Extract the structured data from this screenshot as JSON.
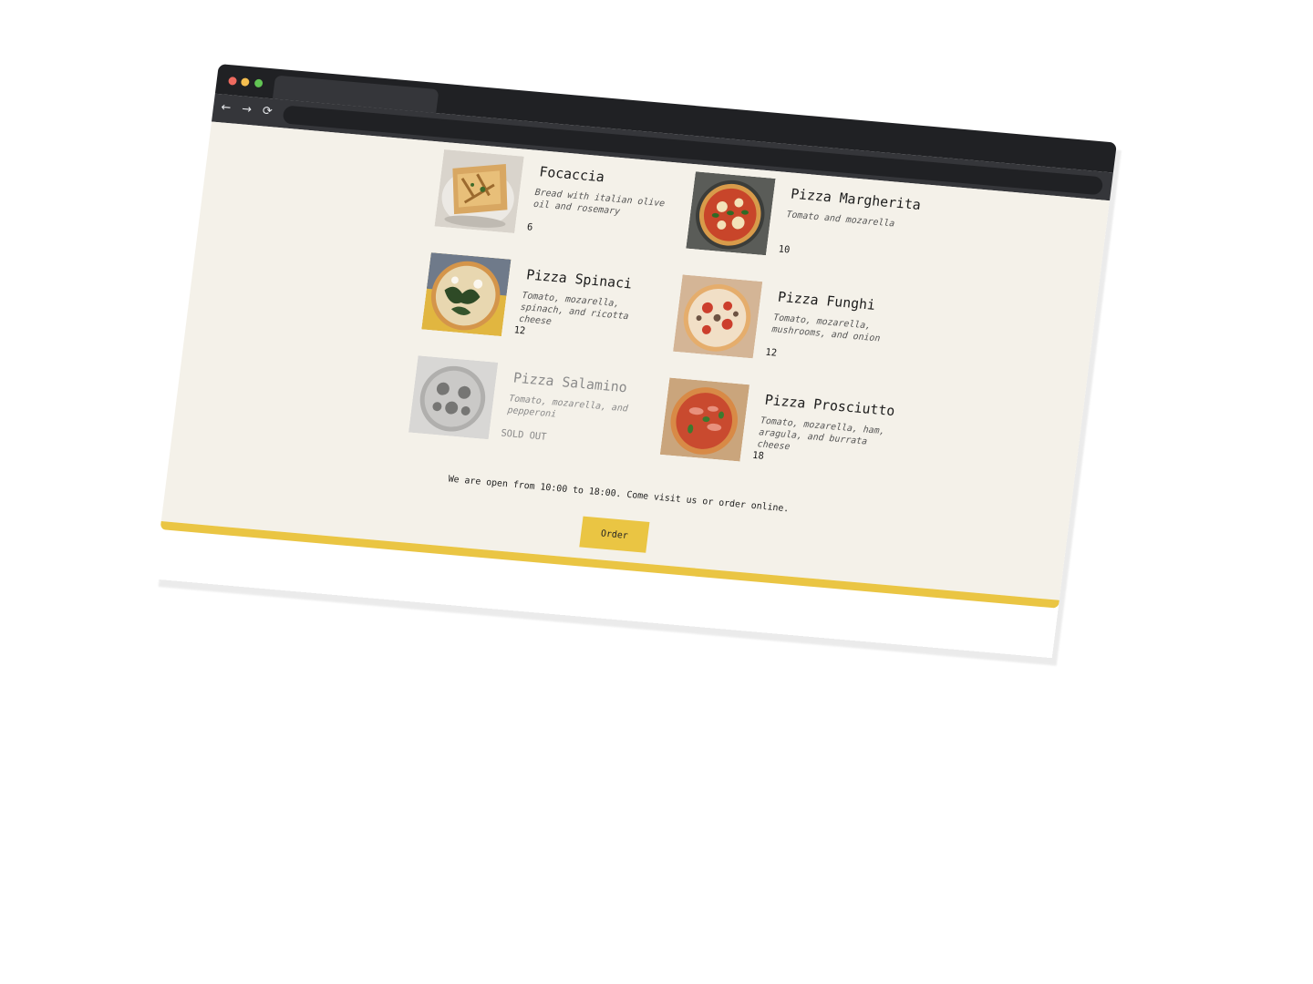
{
  "browser": {
    "nav": {
      "back_icon": "arrow-left-icon",
      "forward_icon": "arrow-right-icon",
      "reload_icon": "reload-icon",
      "back_glyph": "←",
      "forward_glyph": "→",
      "reload_glyph": "⟳"
    },
    "traffic_lights": [
      "#ee6a5f",
      "#f5be4f",
      "#62c554"
    ]
  },
  "menu": {
    "items": [
      {
        "name": "Focaccia",
        "description": "Bread with italian olive oil and rosemary",
        "price": "6",
        "sold_out": false
      },
      {
        "name": "Pizza Margherita",
        "description": "Tomato and mozarella",
        "price": "10",
        "sold_out": false
      },
      {
        "name": "Pizza Spinaci",
        "description": "Tomato, mozarella, spinach, and ricotta cheese",
        "price": "12",
        "sold_out": false
      },
      {
        "name": "Pizza Funghi",
        "description": "Tomato, mozarella, mushrooms, and onion",
        "price": "12",
        "sold_out": false
      },
      {
        "name": "Pizza Salamino",
        "description": "Tomato, mozarella, and pepperoni",
        "price": "SOLD OUT",
        "sold_out": true
      },
      {
        "name": "Pizza Prosciutto",
        "description": "Tomato, mozarella, ham, aragula, and burrata cheese",
        "price": "18",
        "sold_out": false
      }
    ]
  },
  "footer": {
    "hours_text": "We are open from 10:00 to 18:00. Come visit us or order online.",
    "order_label": "Order"
  },
  "colors": {
    "page_bg": "#f4f1e9",
    "accent": "#eac543",
    "chrome_dark": "#202124",
    "chrome_mid": "#35363a"
  }
}
